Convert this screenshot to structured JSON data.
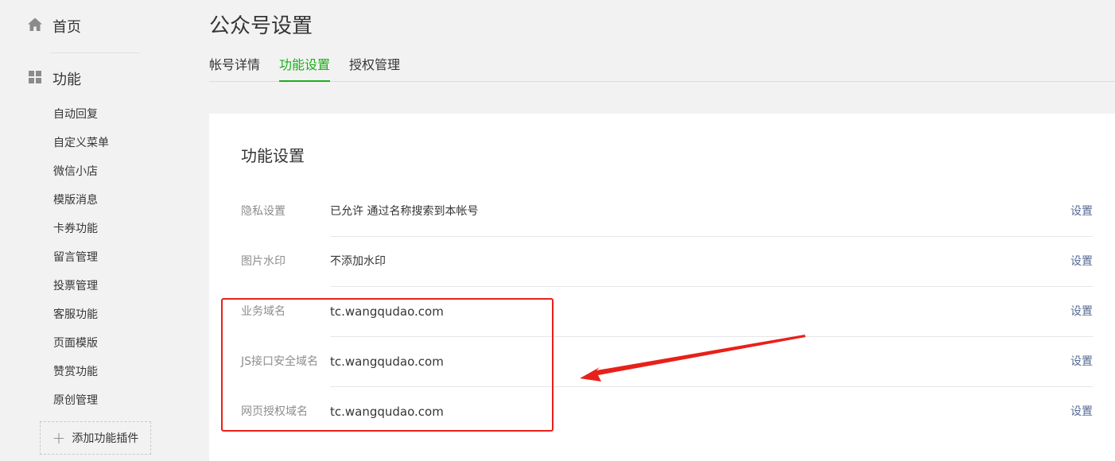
{
  "sidebar": {
    "home_label": "首页",
    "function_label": "功能",
    "items": [
      {
        "label": "自动回复"
      },
      {
        "label": "自定义菜单"
      },
      {
        "label": "微信小店"
      },
      {
        "label": "模版消息"
      },
      {
        "label": "卡券功能"
      },
      {
        "label": "留言管理"
      },
      {
        "label": "投票管理"
      },
      {
        "label": "客服功能"
      },
      {
        "label": "页面模版"
      },
      {
        "label": "赞赏功能"
      },
      {
        "label": "原创管理"
      }
    ],
    "add_plugin_label": "添加功能插件"
  },
  "header": {
    "title": "公众号设置"
  },
  "tabs": [
    {
      "label": "帐号详情",
      "active": false
    },
    {
      "label": "功能设置",
      "active": true
    },
    {
      "label": "授权管理",
      "active": false
    }
  ],
  "card": {
    "title": "功能设置",
    "rows": [
      {
        "key": "隐私设置",
        "value": "已允许 通过名称搜索到本帐号",
        "action": "设置"
      },
      {
        "key": "图片水印",
        "value": "不添加水印",
        "action": "设置"
      },
      {
        "key": "业务域名",
        "value": "tc.wangqudao.com",
        "action": "设置"
      },
      {
        "key": "JS接口安全域名",
        "value": "tc.wangqudao.com",
        "action": "设置"
      },
      {
        "key": "网页授权域名",
        "value": "tc.wangqudao.com",
        "action": "设置"
      }
    ]
  },
  "colors": {
    "accent": "#1aad19",
    "link": "#576b95",
    "annotation": "#e8201a"
  }
}
